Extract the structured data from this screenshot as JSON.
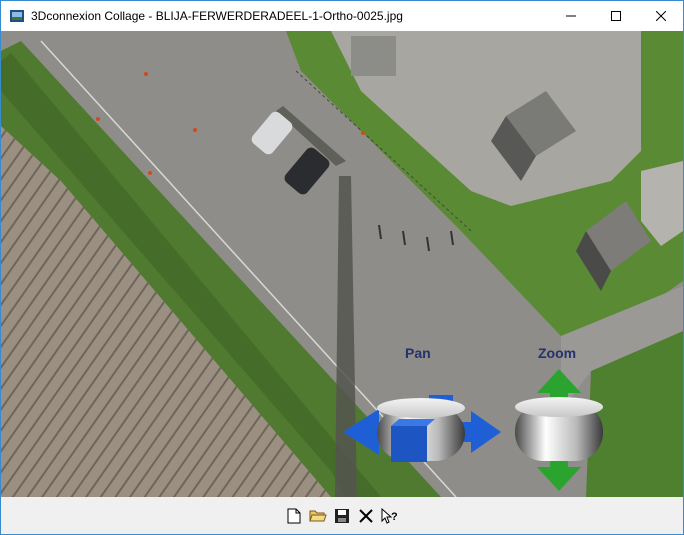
{
  "window": {
    "title": "3Dconnexion Collage - BLIJA-FERWERDERADEEL-1-Ortho-0025.jpg",
    "controls": [
      "minimize",
      "maximize",
      "close"
    ]
  },
  "overlay": {
    "pan_label": "Pan",
    "zoom_label": "Zoom"
  },
  "toolbar": {
    "buttons": [
      {
        "name": "new",
        "icon": "new-document-icon"
      },
      {
        "name": "open",
        "icon": "open-folder-icon"
      },
      {
        "name": "save",
        "icon": "save-icon"
      },
      {
        "name": "delete",
        "icon": "delete-x-icon"
      },
      {
        "name": "help",
        "icon": "context-help-icon"
      }
    ]
  },
  "colors": {
    "accent": "#1e5fd6",
    "zoom_arrow": "#2aa42e",
    "label": "#24326e"
  }
}
